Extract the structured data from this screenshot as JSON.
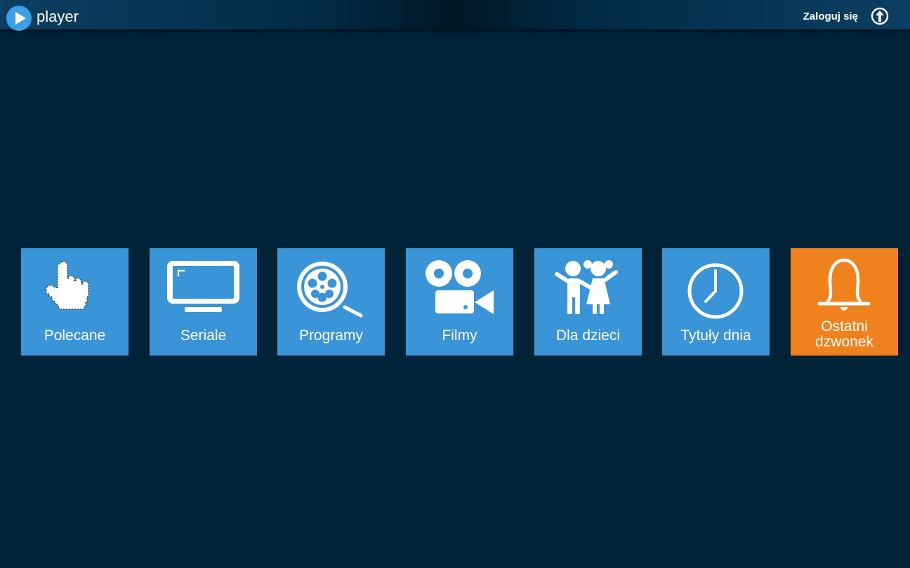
{
  "header": {
    "app_name": "player",
    "login_label": "Zaloguj się",
    "logo_icon": "play-icon",
    "login_icon": "upload-arrow-icon"
  },
  "colors": {
    "background": "#002337",
    "tile_blue": "#3994d8",
    "tile_orange": "#f0821e"
  },
  "tiles": [
    {
      "label": "Polecane",
      "icon": "pointing-hand-icon"
    },
    {
      "label": "Seriale",
      "icon": "tv-icon"
    },
    {
      "label": "Programy",
      "icon": "film-reel-search-icon"
    },
    {
      "label": "Filmy",
      "icon": "movie-camera-icon"
    },
    {
      "label": "Dla dzieci",
      "icon": "children-icon"
    },
    {
      "label": "Tytuły dnia",
      "icon": "clock-icon"
    },
    {
      "label_line1": "Ostatni",
      "label_line2": "dzwonek",
      "icon": "bell-icon"
    }
  ]
}
